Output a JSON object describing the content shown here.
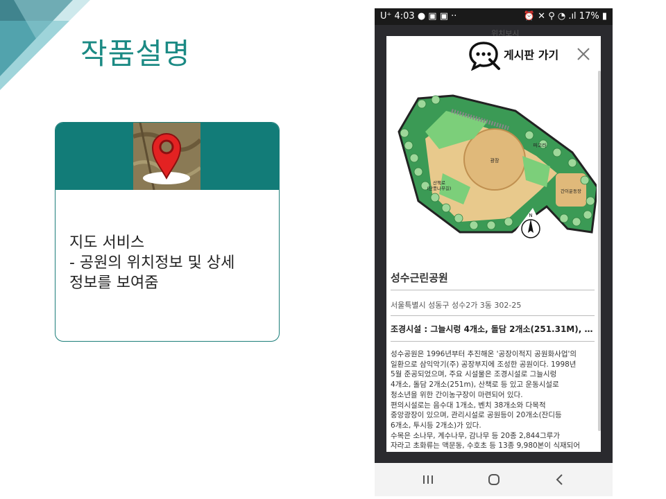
{
  "slide": {
    "title": "작품설명"
  },
  "card": {
    "line1": "지도 서비스",
    "line2": "- 공원의 위치정보 및 상세",
    "line3": "정보를 보여줌"
  },
  "phone": {
    "status": {
      "left": "U⁺ 4:03 ●  ▣ ▣ ··",
      "right": "⏰ ✕ ⚲ ◔ .ıl 17% ▮"
    },
    "map_label": "위치보시",
    "board_label": "게시판 가기",
    "park": {
      "name": "성수근린공원",
      "address": "서울특별시 성동구 성수2가 3동 302-25",
      "facilities": "조경시설 : 그늘시렁 4개소, 돌담 2개소(251.31M), 돌...",
      "description_lines": [
        "성수공원은 1996년부터 추진해온 '공장이적지 공원화사업'의",
        "일환으로 삼익악기(주) 공장부지에 조성한 공원이다. 1998년",
        "5월 준공되었으며, 주요 시설물은 조경시설로 그늘시렁",
        "4개소, 돌담 2개소(251m), 산책로 등 있고 운동시설로",
        "청소년을 위한 간이농구장이 마련되어 있다.",
        "편의시설로는 음수대 1개소, 벤치 38개소와 다목적",
        "중앙광장이 있으며, 관리시설로 공원등이 20개소(잔디등",
        "6개소, 투시등 2개소)가 있다.",
        "수목은 소나무, 계수나무, 감나무 등 20종 2,844그루가",
        "자라고 초화류는 맥문동, 수호초 등 13종 9,980본이 식재되어"
      ]
    },
    "map_labels": {
      "plaza": "광장",
      "walkway_line1": "산책로",
      "walkway_line2": "(단풍나무길)",
      "pergola": "파고라",
      "sports": "간이운동장",
      "north": "N"
    },
    "nav": {
      "recent": "recent-apps",
      "home": "home",
      "back": "back"
    }
  },
  "colors": {
    "accent": "#127c78",
    "title": "#1b8a84"
  }
}
